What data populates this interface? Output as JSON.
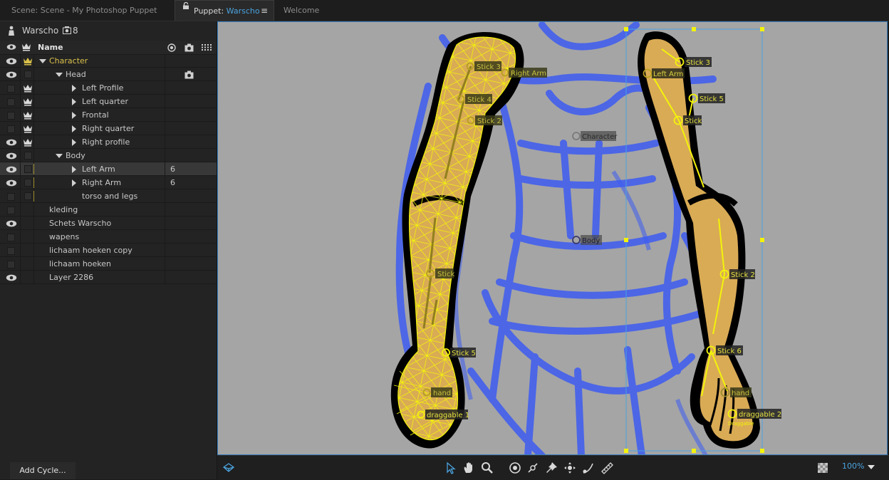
{
  "tabs": [
    {
      "label": "Scene: Scene - My Photoshop Puppet"
    },
    {
      "prefix": "Puppet: ",
      "name": "Warscho",
      "menu": "≡"
    },
    {
      "label": "Welcome"
    }
  ],
  "puppet": {
    "name": "Warscho",
    "count": "8"
  },
  "columns": {
    "name": "Name"
  },
  "layers": [
    {
      "label": "Character",
      "count": ""
    },
    {
      "label": "Head",
      "count": ""
    },
    {
      "label": "Left Profile",
      "count": ""
    },
    {
      "label": "Left quarter",
      "count": ""
    },
    {
      "label": "Frontal",
      "count": ""
    },
    {
      "label": "Right quarter",
      "count": ""
    },
    {
      "label": "Right profile",
      "count": ""
    },
    {
      "label": "Body",
      "count": ""
    },
    {
      "label": "Left Arm",
      "count": "6"
    },
    {
      "label": "Right Arm",
      "count": "6"
    },
    {
      "label": "torso and legs",
      "count": ""
    },
    {
      "label": "kleding",
      "count": ""
    },
    {
      "label": "Schets Warscho",
      "count": ""
    },
    {
      "label": "wapens",
      "count": ""
    },
    {
      "label": "lichaam hoeken copy",
      "count": ""
    },
    {
      "label": "lichaam hoeken",
      "count": ""
    },
    {
      "label": "Layer 2286",
      "count": ""
    }
  ],
  "add_cycle": "Add Cycle...",
  "canvas_labels": {
    "left_arm": [
      "Stick 3",
      "Right Arm",
      "Stick 4",
      "Stick 2",
      "Stick",
      "Stick 5",
      "hand",
      "draggable 1"
    ],
    "center": [
      "Character",
      "Body"
    ],
    "right_arm": [
      "Stick 3",
      "Left Arm",
      "Stick 5",
      "Stick",
      "Stick 2",
      "Stick 6",
      "hand",
      "draggable 2"
    ],
    "draggable_small": "Draggable"
  },
  "zoom": "100%",
  "colors": {
    "accent": "#4aa3df",
    "handle_yellow": "#f3f30a",
    "sketch_blue": "#3d5cf2",
    "skin": "#d9ab55"
  }
}
